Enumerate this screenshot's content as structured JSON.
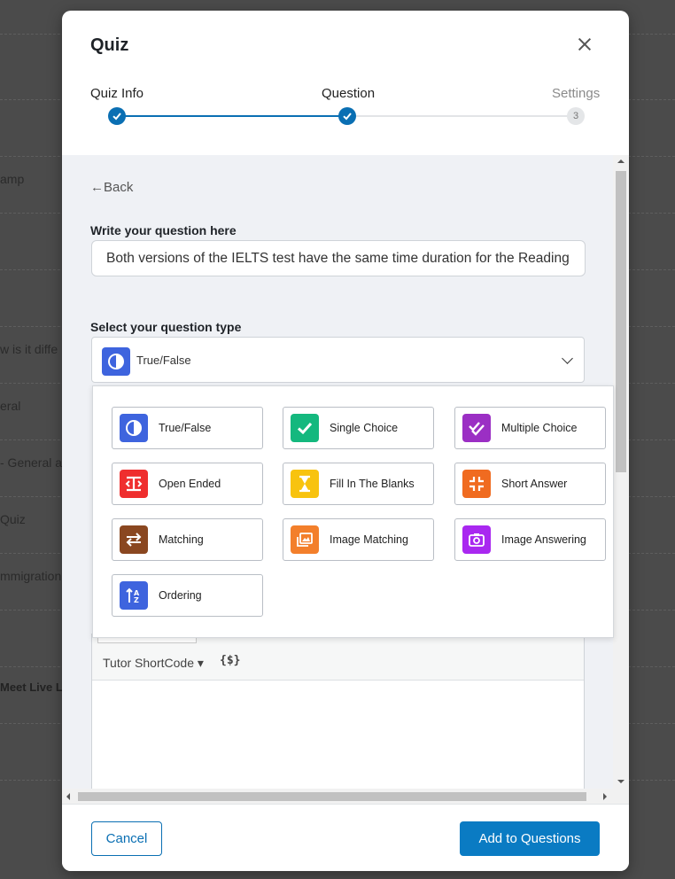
{
  "background": {
    "snippets": [
      "amp",
      "w is it diffe",
      "eral",
      "- General a",
      "Quiz",
      "mmigration",
      "Meet Live L"
    ]
  },
  "modal": {
    "title": "Quiz",
    "steps": [
      {
        "label": "Quiz Info",
        "state": "done"
      },
      {
        "label": "Question",
        "state": "done"
      },
      {
        "label": "Settings",
        "state": "pending",
        "number": "3"
      }
    ],
    "back_label": "←Back",
    "question_label": "Write your question here",
    "question_value": "Both versions of the IELTS test have the same time duration for the Reading",
    "type_label": "Select your question type",
    "selected_type": "True/False",
    "question_types": [
      {
        "name": "True/False",
        "icon": "true-false-icon",
        "color": "#3e64de"
      },
      {
        "name": "Single Choice",
        "icon": "single-choice-icon",
        "color": "#14b87e"
      },
      {
        "name": "Multiple Choice",
        "icon": "multiple-choice-icon",
        "color": "#9b2fc4"
      },
      {
        "name": "Open Ended",
        "icon": "open-ended-icon",
        "color": "#ef2e2e"
      },
      {
        "name": "Fill In The Blanks",
        "icon": "fill-blanks-icon",
        "color": "#f8c30f"
      },
      {
        "name": "Short Answer",
        "icon": "short-answer-icon",
        "color": "#f06b20"
      },
      {
        "name": "Matching",
        "icon": "matching-icon",
        "color": "#8a4720"
      },
      {
        "name": "Image Matching",
        "icon": "image-matching-icon",
        "color": "#f37f2b"
      },
      {
        "name": "Image Answering",
        "icon": "image-answering-icon",
        "color": "#a928f0"
      },
      {
        "name": "Ordering",
        "icon": "ordering-icon",
        "color": "#3e64de"
      }
    ],
    "editor": {
      "shortcode_label": "Tutor ShortCode ▾",
      "shortcode_icon": "{$}"
    },
    "footer": {
      "cancel_label": "Cancel",
      "add_label": "Add to Questions"
    },
    "colors": {
      "accent": "#0a6fb3"
    }
  }
}
